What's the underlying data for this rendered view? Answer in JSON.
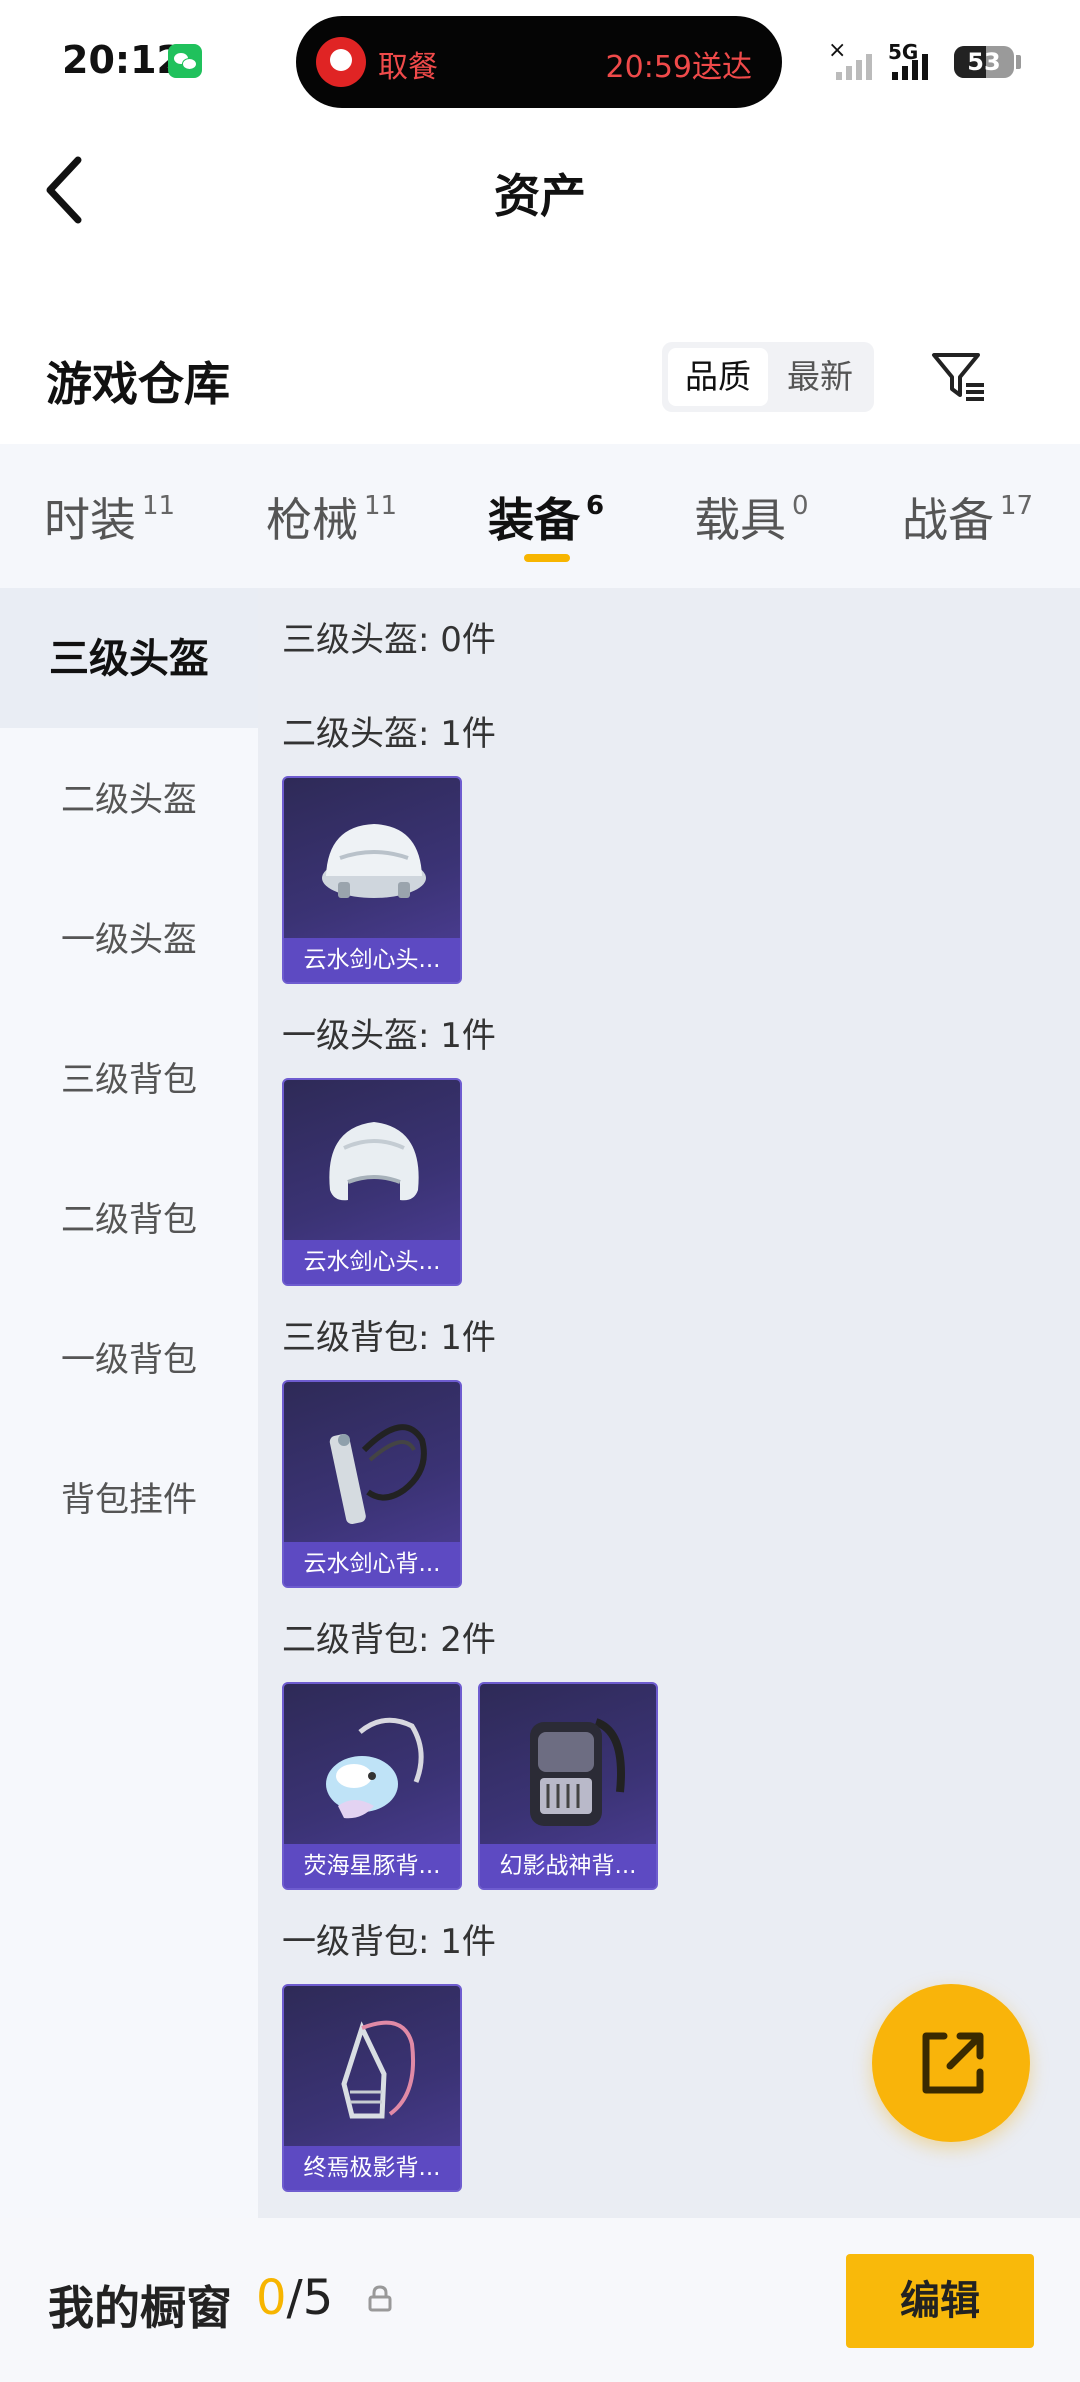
{
  "status_bar": {
    "time": "20:12",
    "notification_left": "取餐",
    "notification_right": "20:59送达",
    "network": "5G",
    "battery": "53",
    "battery_level": 0.53
  },
  "header": {
    "title": "资产"
  },
  "warehouse": {
    "title": "游戏仓库",
    "sort_options": [
      "品质",
      "最新"
    ],
    "selected_sort": "品质"
  },
  "tabs": [
    {
      "label": "时装",
      "count": "11"
    },
    {
      "label": "枪械",
      "count": "11"
    },
    {
      "label": "装备",
      "count": "6"
    },
    {
      "label": "载具",
      "count": "0"
    },
    {
      "label": "战备",
      "count": "17"
    }
  ],
  "active_tab": "装备",
  "sidebar": {
    "items": [
      "三级头盔",
      "二级头盔",
      "一级头盔",
      "三级背包",
      "二级背包",
      "一级背包",
      "背包挂件"
    ],
    "selected": "三级头盔"
  },
  "groups": [
    {
      "title": "三级头盔: 0件",
      "items": []
    },
    {
      "title": "二级头盔: 1件",
      "items": [
        {
          "name": "云水剑心头...",
          "icon": "helmet-icon"
        }
      ]
    },
    {
      "title": "一级头盔: 1件",
      "items": [
        {
          "name": "云水剑心头...",
          "icon": "helmet-icon"
        }
      ]
    },
    {
      "title": "三级背包: 1件",
      "items": [
        {
          "name": "云水剑心背...",
          "icon": "backpack-icon"
        }
      ]
    },
    {
      "title": "二级背包: 2件",
      "items": [
        {
          "name": "荧海星豚背...",
          "icon": "dolphin-backpack-icon"
        },
        {
          "name": "幻影战神背...",
          "icon": "armored-backpack-icon"
        }
      ]
    },
    {
      "title": "一级背包: 1件",
      "items": [
        {
          "name": "终焉极影背...",
          "icon": "backpack-icon"
        }
      ]
    }
  ],
  "bottom_bar": {
    "label": "我的橱窗",
    "current": "0",
    "total": "/5",
    "edit_label": "编辑"
  },
  "colors": {
    "accent": "#f9b90a",
    "card_bg": "#3b3375",
    "card_label": "#5d4ac2"
  }
}
